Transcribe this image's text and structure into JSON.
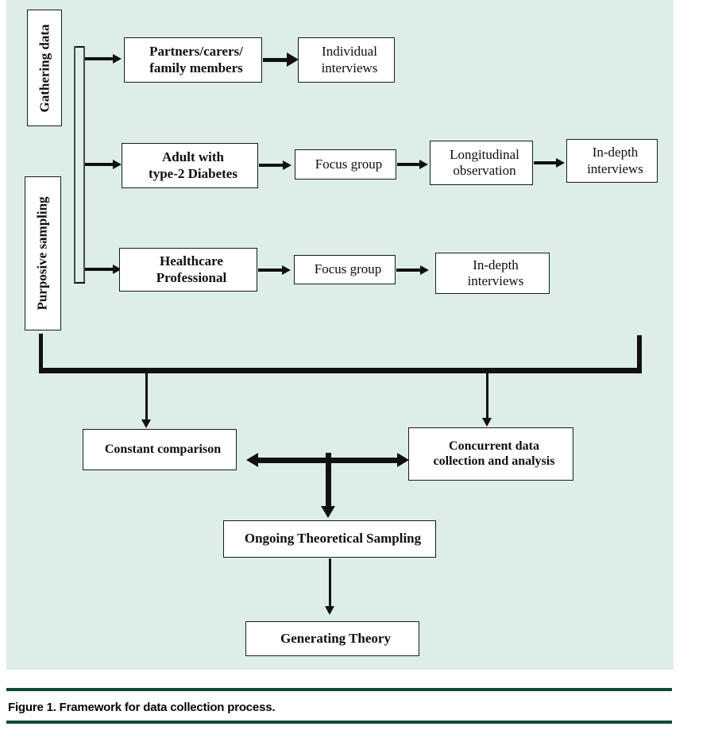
{
  "figure": {
    "caption": "Figure 1. Framework for data collection process.",
    "panel_background": "#ddeeea",
    "rule_color": "#0e4a3c",
    "line_color": "#111111"
  },
  "side_labels": [
    {
      "id": "gathering-data",
      "text": "Gathering data"
    },
    {
      "id": "purposive-sampling",
      "text": "Purposive sampling"
    }
  ],
  "participants": [
    {
      "id": "partners",
      "line1": "Partners/carers/",
      "line2": "family members"
    },
    {
      "id": "adults",
      "line1": "Adult with",
      "line2": "type-2 Diabetes"
    },
    {
      "id": "healthcare",
      "line1": "Healthcare",
      "line2": "Professional"
    }
  ],
  "methods": {
    "row1": [
      {
        "id": "individual-interviews",
        "line1": "Individual",
        "line2": "interviews"
      }
    ],
    "row2": [
      {
        "id": "focus-group-2",
        "line1": "Focus group",
        "line2": ""
      },
      {
        "id": "longitudinal-observation",
        "line1": "Longitudinal",
        "line2": "observation"
      },
      {
        "id": "in-depth-interviews-2",
        "line1": "In-depth",
        "line2": "interviews"
      }
    ],
    "row3": [
      {
        "id": "focus-group-3",
        "line1": "Focus group",
        "line2": ""
      },
      {
        "id": "in-depth-interviews-3",
        "line1": "In-depth",
        "line2": "interviews"
      }
    ]
  },
  "analysis": {
    "constant_comparison": {
      "line1": "Constant comparison",
      "line2": ""
    },
    "concurrent": {
      "line1": "Concurrent data",
      "line2": "collection and analysis"
    },
    "ongoing_sampling": {
      "line1": "Ongoing Theoretical Sampling",
      "line2": ""
    },
    "generating_theory": {
      "line1": "Generating Theory",
      "line2": ""
    }
  }
}
